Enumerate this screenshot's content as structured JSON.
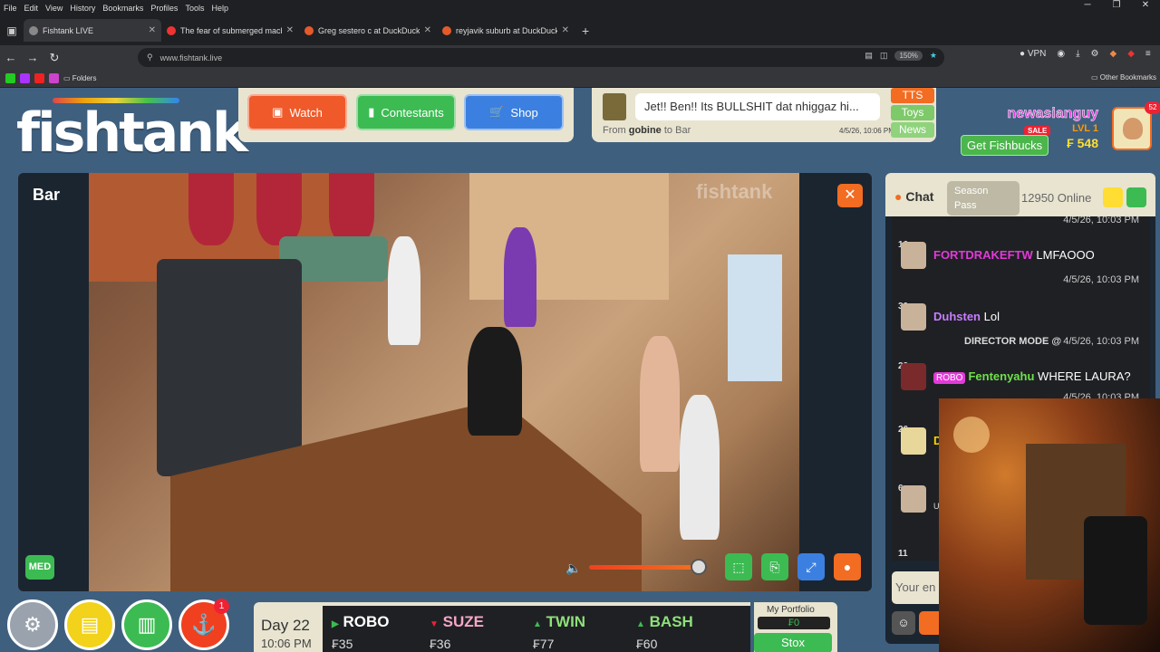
{
  "browser": {
    "menu": [
      "File",
      "Edit",
      "View",
      "History",
      "Bookmarks",
      "Profiles",
      "Tools",
      "Help"
    ],
    "tabs": [
      {
        "title": "Fishtank LIVE",
        "active": true
      },
      {
        "title": "The fear of submerged machine",
        "active": false
      },
      {
        "title": "Greg sestero c at DuckDuckGo",
        "active": false
      },
      {
        "title": "reyjavik suburb at DuckDuckGo",
        "active": false
      }
    ],
    "url": "www.fishtank.live",
    "zoom": "150%",
    "vpn": "VPN",
    "bookmarks": {
      "folders": "Folders",
      "other": "Other Bookmarks"
    }
  },
  "site": {
    "logo": "fishtank",
    "logo_mark": "©",
    "nav": {
      "watch": "Watch",
      "contestants": "Contestants",
      "shop": "Shop"
    },
    "tts": {
      "message": "Jet!! Ben!! Its BULLSHIT dat nhiggaz hi...",
      "from_label": "From",
      "from": "gobine",
      "to_label": "to",
      "to": "Bar",
      "time": "4/5/26, 10:06 PM",
      "tabs": [
        "TTS",
        "Toys",
        "News"
      ]
    },
    "user": {
      "name": "newasianguy",
      "sale": "SALE",
      "level": "LVL 1",
      "get_fishbucks": "Get Fishbucks",
      "balance": "₣ 548",
      "notifications": "52"
    }
  },
  "video": {
    "room": "Bar",
    "watermark": "fishtank",
    "quality": "MED",
    "close": "✕",
    "volume": 0.85
  },
  "chat": {
    "title": "Chat",
    "season_pass": "Season Pass",
    "online": "12950 Online",
    "messages": [
      {
        "time": "4/5/26, 10:03 PM"
      },
      {
        "level": "16",
        "user": "FORTDRAKEFTW",
        "text": "LMFAOOO",
        "color": "#e23ad8",
        "time": "4/5/26, 10:03 PM"
      },
      {
        "level": "30",
        "user": "Duhsten",
        "text": "Lol",
        "color": "#c77dff",
        "time": "4/5/26, 10:03 PM",
        "director": "DIRECTOR MODE @"
      },
      {
        "level": "23",
        "badge": "ROBO",
        "user": "Fentenyahu",
        "text": "WHERE LAURA?",
        "color": "#6fe04a",
        "time": "4/5/26, 10:03 PM"
      },
      {
        "level": "26",
        "user": "D",
        "text": "",
        "color": "#f5d000"
      },
      {
        "level": "6",
        "user": "",
        "text": "U",
        "color": "#ddd"
      },
      {
        "level": "11",
        "user": "",
        "text": "",
        "color": "#ddd"
      }
    ],
    "input_placeholder": "Your en"
  },
  "ticker": {
    "day": "Day 22",
    "time": "10:06 PM",
    "stocks": [
      {
        "name": "ROBO",
        "price": "₣35",
        "dir": "up"
      },
      {
        "name": "SUZE",
        "price": "₣36",
        "dir": "down"
      },
      {
        "name": "TWIN",
        "price": "₣77",
        "dir": "up"
      },
      {
        "name": "BASH",
        "price": "₣60",
        "dir": "up"
      }
    ],
    "portfolio_label": "My Portfolio",
    "portfolio_value": "₣0",
    "stox": "Stox"
  },
  "round_buttons": {
    "badge": "1"
  },
  "colors": {
    "orange": "#f26c22",
    "green": "#3cbb52",
    "blue": "#3b80e0",
    "panel": "#e8e4d0",
    "page_bg": "#3f5f7f"
  }
}
